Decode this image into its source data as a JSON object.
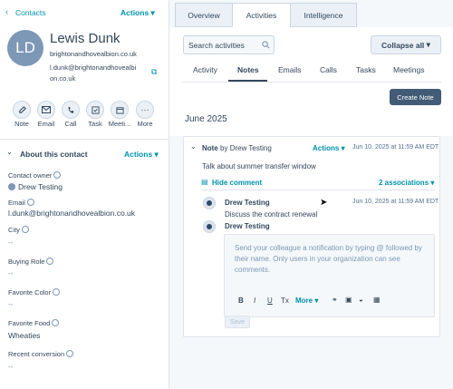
{
  "contact": {
    "back_link": "Contacts",
    "actions_label": "Actions",
    "initials": "LD",
    "name": "Lewis Dunk",
    "website": "brightonandhovealbion.co.uk",
    "email": "l.dunk@brightonandhovealbion.co.uk",
    "email_line1": "l.dunk@brightonandhovealbi",
    "email_line2": "on.co.uk"
  },
  "quick_actions": [
    {
      "label": "Note",
      "icon": "note-icon"
    },
    {
      "label": "Email",
      "icon": "email-icon"
    },
    {
      "label": "Call",
      "icon": "phone-icon"
    },
    {
      "label": "Task",
      "icon": "task-icon"
    },
    {
      "label": "Meeti...",
      "icon": "calendar-icon"
    },
    {
      "label": "More",
      "icon": "more-icon"
    }
  ],
  "about": {
    "heading": "About this contact",
    "actions_label": "Actions",
    "fields": [
      {
        "label": "Contact owner",
        "value": "Drew Testing"
      },
      {
        "label": "Email",
        "value": "l.dunk@brightonandhovealbion.co.uk"
      },
      {
        "label": "City",
        "value": "--"
      },
      {
        "label": "Buying Role",
        "value": "--"
      },
      {
        "label": "Favorite Color",
        "value": "--"
      },
      {
        "label": "Favorite Food",
        "value": "Wheaties"
      },
      {
        "label": "Recent conversion",
        "value": "--"
      }
    ]
  },
  "top_tabs": [
    "Overview",
    "Activities",
    "Intelligence"
  ],
  "search": {
    "placeholder": "Search activities"
  },
  "collapse_label": "Collapse all",
  "sub_tabs": [
    "Activity",
    "Notes",
    "Emails",
    "Calls",
    "Tasks",
    "Meetings"
  ],
  "create_note_label": "Create Note",
  "month_heading": "June 2025",
  "note": {
    "title": "Note",
    "by_text": "by Drew Testing",
    "actions_label": "Actions",
    "timestamp": "Jun 10, 2025 at 11:59 AM EDT",
    "body": "Talk about summer transfer window",
    "hide_comment": "Hide comment",
    "associations": "2 associations",
    "comment_author": "Drew Testing",
    "comment_timestamp": "Jun 10, 2025 at 11:59 AM EDT",
    "comment_body": "Discuss the contract renewal",
    "reply_author": "Drew Testing",
    "reply_placeholder": "Send your colleague a notification by typing @ followed by their name. Only users in your organization can see comments.",
    "toolbar": {
      "bold": "B",
      "italic": "I",
      "underline": "U",
      "strike": "Tx",
      "more": "More"
    },
    "save_label": "Save"
  },
  "colors": {
    "accent": "#0091ae",
    "dark_button": "#425b76",
    "avatar": "#7c98b6"
  }
}
